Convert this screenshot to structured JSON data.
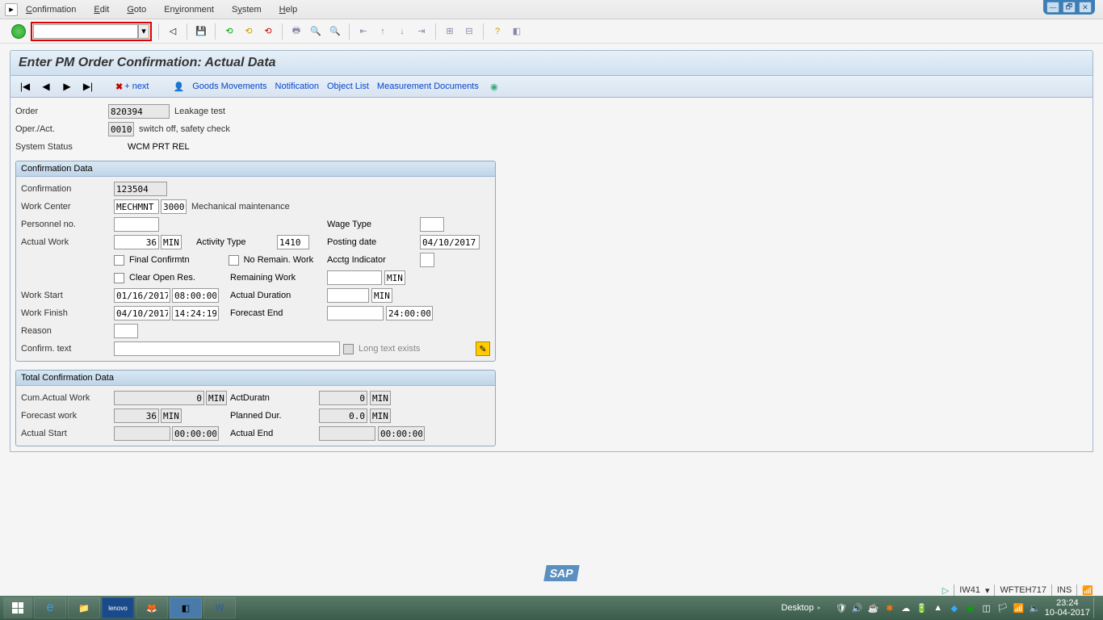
{
  "menu": {
    "confirmation": "Confirmation",
    "edit": "Edit",
    "goto": "Goto",
    "environment": "Environment",
    "system": "System",
    "help": "Help"
  },
  "title": "Enter PM Order Confirmation: Actual Data",
  "apptb": {
    "next": "+ next",
    "goods": "Goods Movements",
    "notification": "Notification",
    "objlist": "Object List",
    "measdoc": "Measurement Documents"
  },
  "header": {
    "order_lbl": "Order",
    "order": "820394",
    "order_desc": "Leakage test",
    "oper_lbl": "Oper./Act.",
    "oper": "0010",
    "oper_desc": "switch off, safety check",
    "status_lbl": "System Status",
    "status": "WCM  PRT  REL"
  },
  "confdata": {
    "title": "Confirmation Data",
    "conf_lbl": "Confirmation",
    "conf": "123504",
    "wc_lbl": "Work Center",
    "wc1": "MECHMNT",
    "wc2": "3000",
    "wc_desc": "Mechanical maintenance",
    "pno_lbl": "Personnel no.",
    "pno": "",
    "wage_lbl": "Wage Type",
    "wage": "",
    "awork_lbl": "Actual Work",
    "awork": "36",
    "awork_u": "MIN",
    "atype_lbl": "Activity Type",
    "atype": "1410",
    "pdate_lbl": "Posting date",
    "pdate": "04/10/2017",
    "final": "Final Confirmtn",
    "noremain": "No Remain. Work",
    "acctg_lbl": "Acctg Indicator",
    "clear": "Clear Open Res.",
    "remwork_lbl": "Remaining Work",
    "remwork_u": "MIN",
    "wstart_lbl": "Work Start",
    "wstart_d": "01/16/2017",
    "wstart_t": "08:00:00",
    "adur_lbl": "Actual Duration",
    "adur_u": "MIN",
    "wfin_lbl": "Work Finish",
    "wfin_d": "04/10/2017",
    "wfin_t": "14:24:19",
    "fend_lbl": "Forecast End",
    "fend_t": "24:00:00",
    "reason_lbl": "Reason",
    "ctext_lbl": "Confirm. text",
    "ltext": "Long text exists"
  },
  "total": {
    "title": "Total Confirmation Data",
    "cum_lbl": "Cum.Actual Work",
    "cum": "0",
    "cum_u": "MIN",
    "ad_lbl": "ActDuratn",
    "ad": "0",
    "ad_u": "MIN",
    "fw_lbl": "Forecast work",
    "fw": "36",
    "fw_u": "MIN",
    "pd_lbl": "Planned Dur.",
    "pd": "0.0",
    "pd_u": "MIN",
    "as_lbl": "Actual Start",
    "as_t": "00:00:00",
    "ae_lbl": "Actual End",
    "ae_t": "00:00:00"
  },
  "status": {
    "tc": "IW41",
    "srv": "WFTEH717",
    "mode": "INS"
  },
  "taskbar": {
    "desktop": "Desktop",
    "time": "23:24",
    "date": "10-04-2017"
  }
}
